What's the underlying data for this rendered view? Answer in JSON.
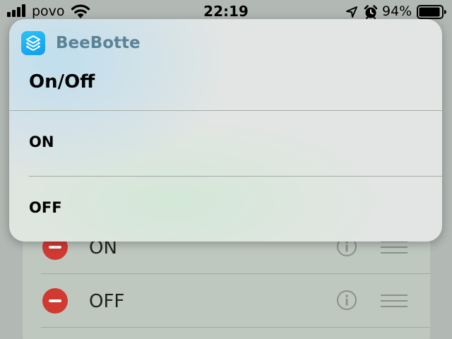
{
  "status_bar": {
    "carrier": "povo",
    "time": "22:19",
    "battery_percent": "94%",
    "battery_level": 0.94,
    "icons": [
      "signal-icon",
      "wifi-icon",
      "location-arrow-icon",
      "alarm-clock-icon",
      "battery-icon"
    ]
  },
  "popup": {
    "app_name": "BeeBotte",
    "app_icon": "shortcuts-layers-icon",
    "title": "On/Off",
    "options": [
      {
        "label": "ON"
      },
      {
        "label": "OFF"
      }
    ]
  },
  "background_list": {
    "items": [
      {
        "label": "ON",
        "icons": [
          "remove-icon",
          "info-icon",
          "reorder-icon"
        ]
      },
      {
        "label": "OFF",
        "icons": [
          "remove-icon",
          "info-icon",
          "reorder-icon"
        ]
      }
    ]
  },
  "colors": {
    "app_icon": "#1aaef5",
    "app_name": "#5b8296",
    "remove_button": "#d03a31"
  }
}
